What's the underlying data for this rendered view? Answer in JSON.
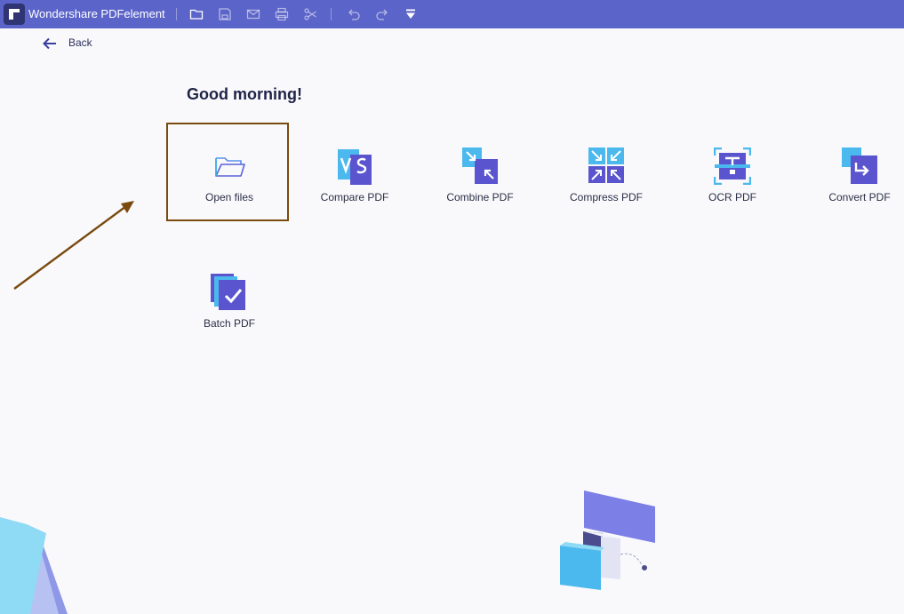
{
  "app": {
    "title": "Wondershare PDFelement"
  },
  "toolbar": {
    "icons": [
      "folder-icon",
      "save-icon",
      "mail-icon",
      "print-icon",
      "scissors-icon",
      "undo-icon",
      "redo-icon",
      "dropdown-icon"
    ]
  },
  "nav": {
    "back_label": "Back"
  },
  "greeting": "Good morning!",
  "tools": [
    {
      "label": "Open files",
      "icon": "folder-open-icon"
    },
    {
      "label": "Compare PDF",
      "icon": "compare-icon"
    },
    {
      "label": "Combine PDF",
      "icon": "combine-icon"
    },
    {
      "label": "Compress PDF",
      "icon": "compress-icon"
    },
    {
      "label": "OCR PDF",
      "icon": "ocr-icon"
    },
    {
      "label": "Convert PDF",
      "icon": "convert-icon"
    },
    {
      "label": "Batch PDF",
      "icon": "batch-icon"
    }
  ],
  "colors": {
    "titlebar": "#5b64c8",
    "accent": "#5b5fd6",
    "highlight": "#7a4a0e",
    "background": "#f9f9fc"
  }
}
